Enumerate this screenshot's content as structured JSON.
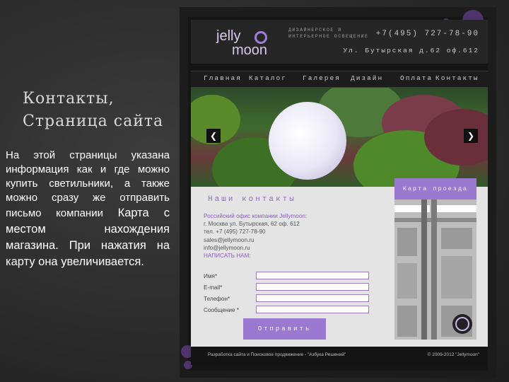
{
  "slide": {
    "title_line1": "Контакты,",
    "title_line2": "Страница сайта",
    "text_normal": "На этой страницы указана информация как и где можно купить светильники, а также можно сразу же отправить письмо компании",
    "text_big": "Карта с местом нахождения магазина. При нажатия на карту она увеличивается."
  },
  "site": {
    "logo_line1": "jelly",
    "logo_line2": "moon",
    "header_sub": "ДИЗАЙНЕРСКОЕ И ИНТЕРЬЕРНОЕ ОСВЕЩЕНИЕ",
    "header_phone": "+7(495) 727-78-90",
    "header_address": "Ул. Бутырская д.62 оф.612",
    "nav": [
      "Главная",
      "Каталог",
      "Галерея",
      "Дизайн",
      "Оплата",
      "Контакты"
    ],
    "slider_prev": "❮",
    "slider_next": "❯",
    "contacts_title": "Наши контакты",
    "contact_lines": [
      "Российский офис компании Jellymoon:",
      "г. Москва ул. Бутырская, 62 оф. 612",
      "тел. +7 (495) 727-78-90",
      "sales@jellymoon.ru",
      "info@jellymoon.ru",
      "НАПИСАТЬ НАМ:"
    ],
    "form": {
      "name": "Имя*",
      "email": "E-mail*",
      "phone": "Телефон*",
      "message": "Сообщение *",
      "submit": "Отправить"
    },
    "map_tab": "Карта проезда",
    "footer_left": "Разработка сайта и Поисковое продвижение - \"Азбука Решений\"",
    "footer_right": "© 2009-2012 \"Jellymoon\""
  },
  "colors": {
    "accent": "#9c79d0",
    "background": "#2a2a2a"
  }
}
